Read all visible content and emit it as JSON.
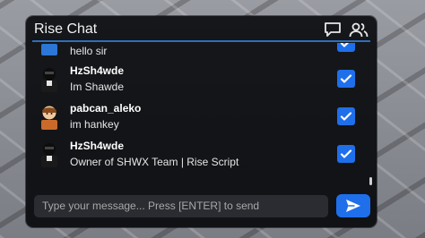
{
  "window": {
    "title": "Rise Chat"
  },
  "header": {
    "icons": [
      "chat-bubble-icon",
      "users-icon"
    ]
  },
  "messages": [
    {
      "username": "",
      "text": "hello sir",
      "checked": true
    },
    {
      "username": "HzSh4wde",
      "text": "Im Shawde",
      "checked": true
    },
    {
      "username": "pabcan_aleko",
      "text": "im hankey",
      "checked": true
    },
    {
      "username": "HzSh4wde",
      "text": "Owner of SHWX Team | Rise Script",
      "checked": true
    }
  ],
  "composer": {
    "placeholder": "Type your message... Press [ENTER] to send",
    "send_icon": "send-icon"
  },
  "colors": {
    "accent": "#1f6feb",
    "panel": "#131519",
    "rule": "#2e6fb8"
  }
}
